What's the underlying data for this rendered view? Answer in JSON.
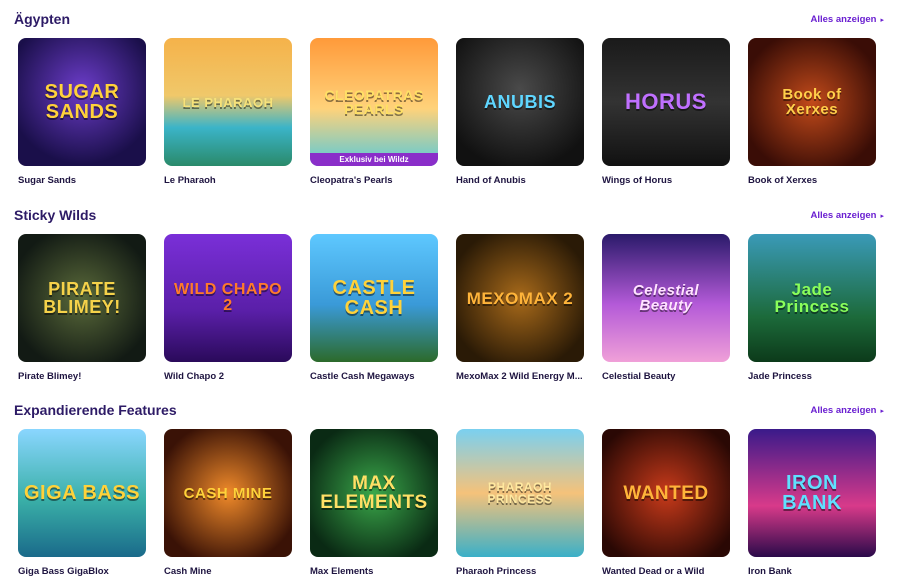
{
  "see_all_label": "Alles anzeigen",
  "sections": [
    {
      "title": "Ägypten",
      "games": [
        {
          "name": "Sugar Sands",
          "art": "SUGAR SANDS",
          "art_color": "#ffd23a"
        },
        {
          "name": "Le Pharaoh",
          "art": "LE PHARAOH",
          "art_color": "#f7e27a"
        },
        {
          "name": "Cleopatra's Pearls",
          "art": "CLEOPATRAS PEARLS",
          "art_color": "#ffe066",
          "ribbon": "Exklusiv bei Wildz"
        },
        {
          "name": "Hand of Anubis",
          "art": "ANUBIS",
          "art_color": "#5fd6ff"
        },
        {
          "name": "Wings of Horus",
          "art": "HORUS",
          "art_color": "#c070ff"
        },
        {
          "name": "Book of Xerxes",
          "art": "Book of Xerxes",
          "art_color": "#ffcf4a"
        }
      ]
    },
    {
      "title": "Sticky Wilds",
      "games": [
        {
          "name": "Pirate Blimey!",
          "art": "PIRATE BLIMEY!",
          "art_color": "#f5d24a"
        },
        {
          "name": "Wild Chapo 2",
          "art": "WILD CHAPO 2",
          "art_color": "#ff7a2a"
        },
        {
          "name": "Castle Cash Megaways",
          "art": "CASTLE CASH",
          "art_color": "#ffd23a"
        },
        {
          "name": "MexoMax 2 Wild Energy M...",
          "art": "MEXOMAX 2",
          "art_color": "#ffb43a"
        },
        {
          "name": "Celestial Beauty",
          "art": "Celestial Beauty",
          "art_color": "#ffe3ff"
        },
        {
          "name": "Jade Princess",
          "art": "Jade Princess",
          "art_color": "#8aff5a"
        }
      ]
    },
    {
      "title": "Expandierende Features",
      "games": [
        {
          "name": "Giga Bass GigaBlox",
          "art": "GIGA BASS",
          "art_color": "#ffd23a"
        },
        {
          "name": "Cash Mine",
          "art": "CASH MINE",
          "art_color": "#ffd23a"
        },
        {
          "name": "Max Elements",
          "art": "MAX ELEMENTS",
          "art_color": "#ffe066"
        },
        {
          "name": "Pharaoh Princess",
          "art": "PHARAOH PRINCESS",
          "art_color": "#ffe9a0"
        },
        {
          "name": "Wanted Dead or a Wild",
          "art": "WANTED",
          "art_color": "#ffb43a"
        },
        {
          "name": "Iron Bank",
          "art": "IRON BANK",
          "art_color": "#5fe0ff"
        }
      ]
    }
  ]
}
